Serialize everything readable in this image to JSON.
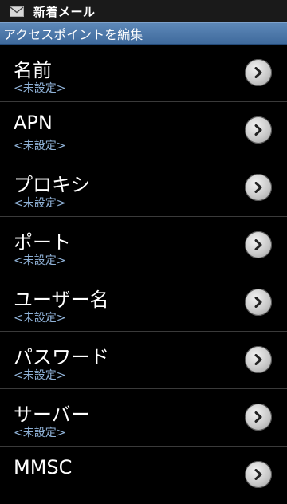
{
  "status_bar": {
    "notification": "新着メール",
    "icon": "mail-icon"
  },
  "title_bar": {
    "title": "アクセスポイントを編集"
  },
  "settings": [
    {
      "label": "名前",
      "value": "<未設定>"
    },
    {
      "label": "APN",
      "value": "<未設定>"
    },
    {
      "label": "プロキシ",
      "value": "<未設定>"
    },
    {
      "label": "ポート",
      "value": "<未設定>"
    },
    {
      "label": "ユーザー名",
      "value": "<未設定>"
    },
    {
      "label": "パスワード",
      "value": "<未設定>"
    },
    {
      "label": "サーバー",
      "value": "<未設定>"
    },
    {
      "label": "MMSC",
      "value": ""
    }
  ],
  "colors": {
    "title_bar": "#4a76a8",
    "value_text": "#8fb1d6",
    "background": "#000000"
  }
}
